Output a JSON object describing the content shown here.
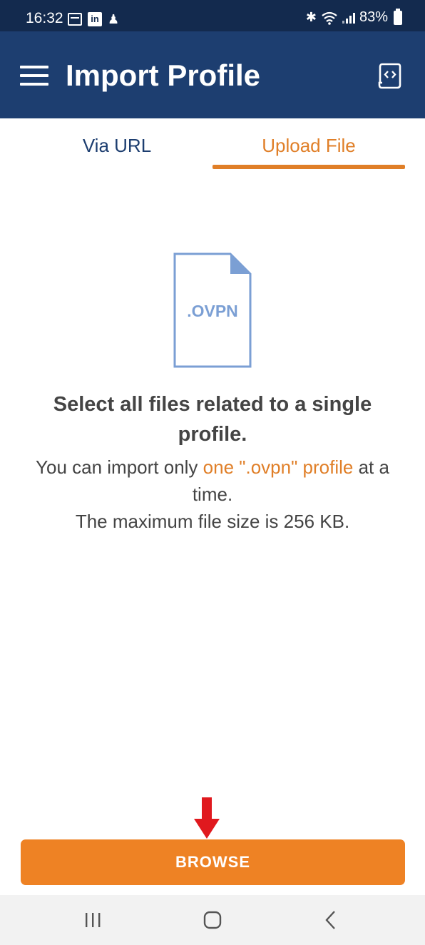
{
  "status_bar": {
    "time": "16:32",
    "battery": "83%",
    "icons": [
      "calendar-icon",
      "linkedin-icon",
      "figure-icon",
      "bluetooth-icon",
      "wifi-icon",
      "signal-icon",
      "battery-icon"
    ]
  },
  "app_bar": {
    "title": "Import Profile",
    "menu_icon": "hamburger-menu-icon",
    "action_icon": "code-file-icon",
    "background": "#1d3e70"
  },
  "tabs": [
    {
      "label": "Via URL",
      "active": false
    },
    {
      "label": "Upload File",
      "active": true
    }
  ],
  "illustration": {
    "label": ".OVPN",
    "color": "#7b9fd4"
  },
  "content": {
    "heading": "Select all files related to a single profile.",
    "line1_prefix": "You can import only ",
    "line1_highlight": "one \".ovpn\" profile",
    "line1_suffix": " at a time.",
    "line2": "The maximum file size is 256 KB."
  },
  "browse": {
    "label": "BROWSE",
    "color": "#ee8224"
  },
  "accent_color": "#e07f28",
  "annotation_arrow_color": "#e0191e",
  "nav_bar": {
    "icons": [
      "recents-icon",
      "home-icon",
      "back-icon"
    ]
  }
}
